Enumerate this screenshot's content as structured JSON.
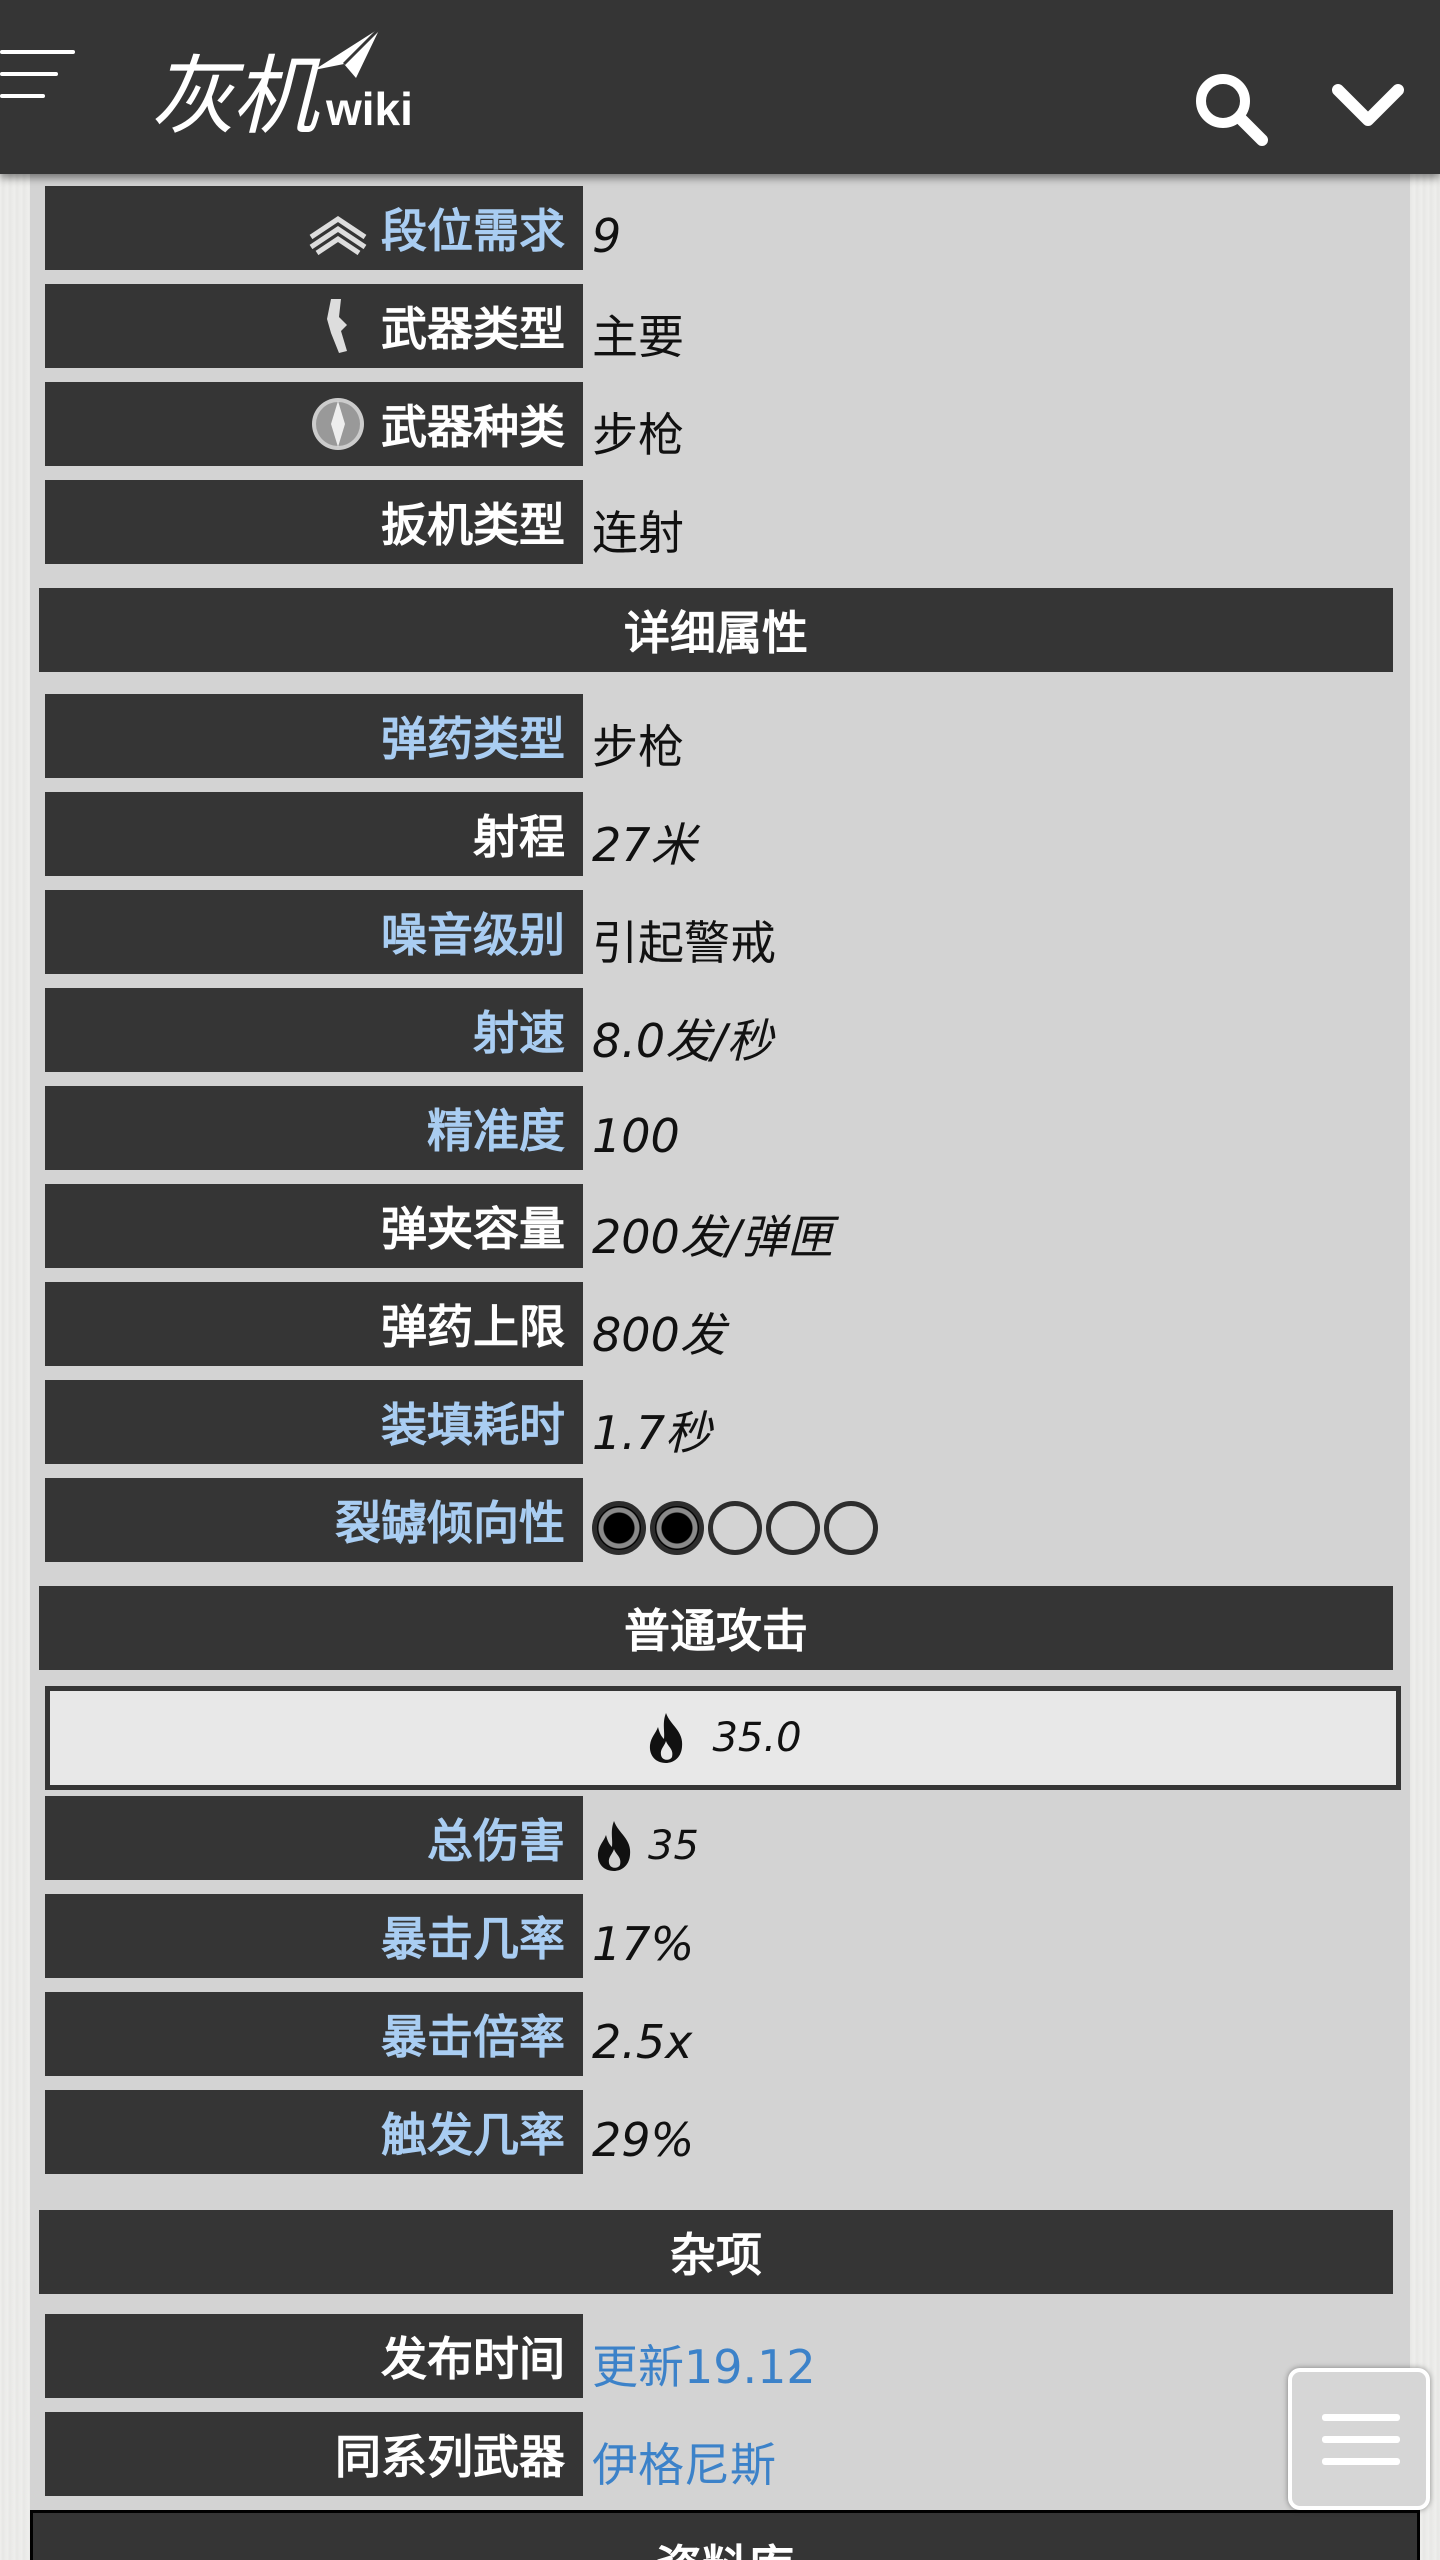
{
  "header": {
    "logo_cn": "灰机",
    "logo_wiki": "wiki",
    "menu_icon": "hamburger-icon",
    "search_icon": "search-icon",
    "dropdown_icon": "chevron-down-icon"
  },
  "rows_top": [
    {
      "label": "段位需求",
      "value": "9",
      "label_link": true,
      "icon": "mastery-rank-icon"
    },
    {
      "label": "武器类型",
      "value": "主要",
      "label_link": false,
      "icon": "primary-weapon-icon"
    },
    {
      "label": "武器种类",
      "value": "步枪",
      "label_link": false,
      "icon": "rifle-class-icon"
    },
    {
      "label": "扳机类型",
      "value": "连射",
      "label_link": false
    }
  ],
  "sections": {
    "details": "详细属性",
    "normal_attack": "普通攻击",
    "misc": "杂项",
    "bottom": "资料库"
  },
  "rows_details": [
    {
      "label": "弹药类型",
      "value": "步枪",
      "label_link": true
    },
    {
      "label": "射程",
      "value": "27米",
      "label_link": false
    },
    {
      "label": "噪音级别",
      "value": "引起警戒",
      "label_link": true
    },
    {
      "label": "射速",
      "value": "8.0发/秒",
      "label_link": true
    },
    {
      "label": "精准度",
      "value": "100",
      "label_link": true
    },
    {
      "label": "弹夹容量",
      "value": "200发/弹匣",
      "label_link": false
    },
    {
      "label": "弹药上限",
      "value": "800发",
      "label_link": false
    },
    {
      "label": "装填耗时",
      "value": "1.7秒",
      "label_link": true
    }
  ],
  "riven": {
    "label": "裂罅倾向性",
    "filled": 2,
    "total": 5
  },
  "attack_box": {
    "value": "35.0",
    "icon": "heat-damage-icon"
  },
  "rows_attack": [
    {
      "label": "总伤害",
      "value": "35",
      "label_link": true,
      "value_icon": "heat-damage-icon"
    },
    {
      "label": "暴击几率",
      "value": "17%",
      "label_link": true
    },
    {
      "label": "暴击倍率",
      "value": "2.5x",
      "label_link": true
    },
    {
      "label": "触发几率",
      "value": "29%",
      "label_link": true
    }
  ],
  "rows_misc": [
    {
      "label": "发布时间",
      "value": "更新19.12",
      "value_link": true
    },
    {
      "label": "同系列武器",
      "value": "伊格尼斯",
      "value_link": true
    }
  ],
  "colors": {
    "header_bg": "#353535",
    "label_bg": "#353535",
    "link_label": "#a9cdf2",
    "link_value": "#3c82c9",
    "infobox_bg": "#d3d3d3"
  }
}
